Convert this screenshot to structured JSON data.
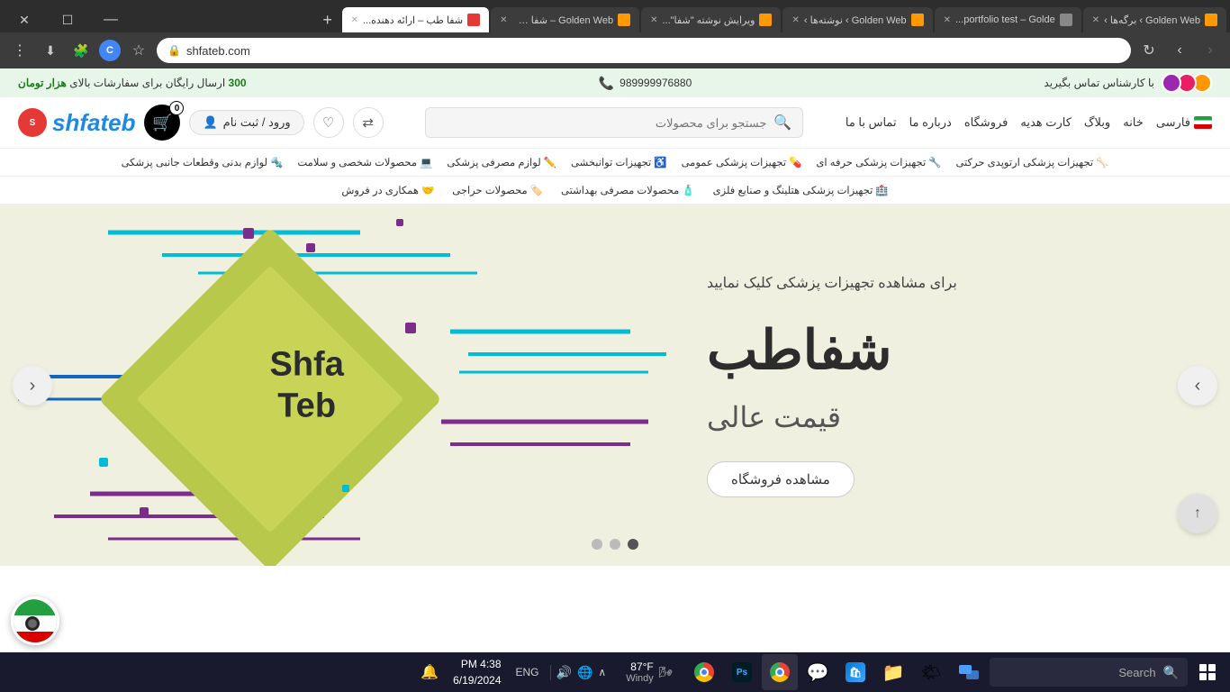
{
  "browser": {
    "url": "shfateb.com",
    "tabs": [
      {
        "id": "tab1",
        "title": "Golden Web › برگه‌ها ›",
        "active": false,
        "favicon_color": "#f90"
      },
      {
        "id": "tab2",
        "title": "portfolio test – Golde...",
        "active": false,
        "favicon_color": "#888"
      },
      {
        "id": "tab3",
        "title": "Golden Web › نوشته‌ها ›",
        "active": false,
        "favicon_color": "#f90"
      },
      {
        "id": "tab4",
        "title": "ویرایش نوشته \"شفا\"...",
        "active": false,
        "favicon_color": "#f90"
      },
      {
        "id": "tab5",
        "title": "Golden Web – شفا طب",
        "active": false,
        "favicon_color": "#f90"
      },
      {
        "id": "tab6",
        "title": "شفا طب – ارائه دهنده...",
        "active": true,
        "favicon_color": "#e53935"
      }
    ],
    "window_controls": {
      "minimize": "—",
      "maximize": "☐",
      "close": "✕"
    }
  },
  "website": {
    "promo_bar": {
      "right_text": "با کارشناس تماس بگیرید",
      "phone": "989999976880",
      "center_text": "ارسال رایگان برای سفارشات بالای ",
      "amount": "300",
      "currency": "هزار تومان"
    },
    "header": {
      "nav_links": [
        "خانه",
        "وبلاگ",
        "کارت هدیه",
        "فروشگاه",
        "درباره ما",
        "تماس با ما"
      ],
      "lang": "فارسی",
      "search_placeholder": "جستجو برای محصولات",
      "logo_text": "shfateb",
      "cart_count": "0",
      "login_label": "ورود / ثبت نام"
    },
    "nav_menu_row1": [
      {
        "label": "تجهیزات پزشکی ارتوپدی حرکتی",
        "icon": "🦴"
      },
      {
        "label": "تجهیزات پزشکی حرفه ای",
        "icon": "🔧"
      },
      {
        "label": "تجهیزات پزشکی عمومی",
        "icon": "💊"
      },
      {
        "label": "تجهیزات توانبخشی",
        "icon": "♿"
      },
      {
        "label": "لوازم مصرفی پزشکی",
        "icon": "✏️"
      },
      {
        "label": "محصولات شخصی و سلامت",
        "icon": "💻"
      },
      {
        "label": "لوازم بدنی وقطعات جانبی پزشکی",
        "icon": "🔩"
      }
    ],
    "nav_menu_row2": [
      {
        "label": "تجهیزات پزشکی هتلینگ و صنایع فلزی",
        "icon": "🏥"
      },
      {
        "label": "محصولات مصرفی بهداشتی",
        "icon": "🧴"
      },
      {
        "label": "محصولات حراجی",
        "icon": "🏷️"
      },
      {
        "label": "همکاری در فروش",
        "icon": "🤝"
      }
    ],
    "hero": {
      "subtitle": "برای مشاهده تجهیزات پزشکی کلیک نمایید",
      "title": "شفاطب",
      "description": "قیمت عالی",
      "cta_label": "مشاهده فروشگاه",
      "graphic_text_line1": "Shfa",
      "graphic_text_line2": "Teb",
      "dots": [
        {
          "active": true
        },
        {
          "active": false
        },
        {
          "active": false
        }
      ]
    }
  },
  "taskbar": {
    "search_placeholder": "Search",
    "time": "4:38 PM",
    "date": "6/19/2024",
    "lang_indicator": "ENG",
    "temperature": "87°F",
    "weather": "Windy",
    "apps": [
      {
        "name": "file-explorer",
        "color": "#f0c040"
      },
      {
        "name": "microsoft-store",
        "color": "#0078d4"
      },
      {
        "name": "messages",
        "color": "#0090f0"
      },
      {
        "name": "chrome",
        "color": "#4caf50"
      },
      {
        "name": "photoshop",
        "color": "#001d26"
      },
      {
        "name": "chrome2",
        "color": "#ea4335"
      }
    ]
  }
}
